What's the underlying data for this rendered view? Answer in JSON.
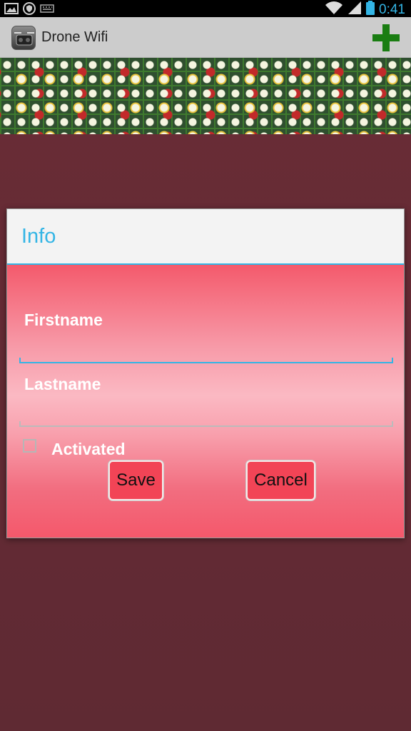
{
  "status_bar": {
    "time": "0:41",
    "icons": [
      "picture-icon",
      "shield-icon",
      "keyboard-icon",
      "wifi-icon",
      "signal-icon",
      "battery-icon"
    ]
  },
  "action_bar": {
    "title": "Drone Wifi",
    "icon": "drone-app-icon",
    "add_icon": "plus-icon",
    "accent": "#1a7d12"
  },
  "dialog": {
    "title": "Info",
    "fields": {
      "firstname": {
        "label": "Firstname",
        "value": ""
      },
      "lastname": {
        "label": "Lastname",
        "value": ""
      }
    },
    "checkbox": {
      "label": "Activated",
      "checked": false
    },
    "buttons": {
      "save": "Save",
      "cancel": "Cancel"
    },
    "accent": "#33b5e5",
    "button_color": "#f24456"
  }
}
